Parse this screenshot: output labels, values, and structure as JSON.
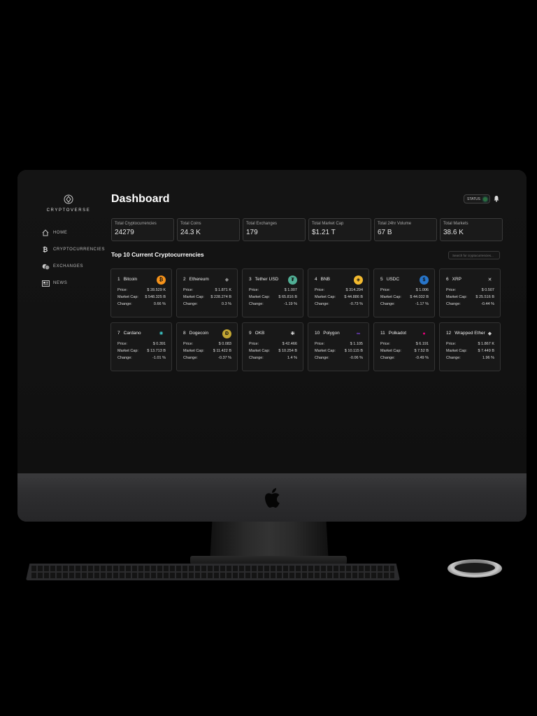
{
  "app": {
    "name": "CRYPTOVERSE"
  },
  "nav": [
    {
      "label": "HOME",
      "icon": "home-icon"
    },
    {
      "label": "CRYPTOCURRENCIES",
      "icon": "bitcoin-icon"
    },
    {
      "label": "EXCHANGES",
      "icon": "coins-icon"
    },
    {
      "label": "NEWS",
      "icon": "newspaper-icon"
    }
  ],
  "header": {
    "title": "Dashboard",
    "status_label": "STATUS"
  },
  "stats": [
    {
      "label": "Total Cryptocurrencies",
      "value": "24279"
    },
    {
      "label": "Total Coins",
      "value": "24.3 K"
    },
    {
      "label": "Total Exchanges",
      "value": "179"
    },
    {
      "label": "Total Market Cap",
      "value": "$1.21 T"
    },
    {
      "label": "Total 24hr Volume",
      "value": "67 B"
    },
    {
      "label": "Total Markets",
      "value": "38.6 K"
    }
  ],
  "section": {
    "title": "Top 10 Current Cryptocurrencies",
    "search_placeholder": "Search for cryptocurrencies..."
  },
  "labels": {
    "price": "Price:",
    "market_cap": "Market Cap:",
    "change": "Change:"
  },
  "coins": [
    {
      "rank": "1",
      "name": "Bitcoin",
      "price": "$ 28.529 K",
      "market_cap": "$ 548.325 B",
      "change": "0.66 %",
      "icon": "bitcoin-coin-icon",
      "color": "#f7931a"
    },
    {
      "rank": "2",
      "name": "Ethereum",
      "price": "$ 1.871 K",
      "market_cap": "$ 228.274 B",
      "change": "0.3 %",
      "icon": "ethereum-coin-icon",
      "color": "#8c8c8c"
    },
    {
      "rank": "3",
      "name": "Tether USD",
      "price": "$ 1.007",
      "market_cap": "$ 65.816 B",
      "change": "-1.19 %",
      "icon": "tether-coin-icon",
      "color": "#50af95"
    },
    {
      "rank": "4",
      "name": "BNB",
      "price": "$ 314.294",
      "market_cap": "$ 44.886 B",
      "change": "-0.73 %",
      "icon": "bnb-coin-icon",
      "color": "#f3ba2f"
    },
    {
      "rank": "5",
      "name": "USDC",
      "price": "$ 1.006",
      "market_cap": "$ 44.032 B",
      "change": "-1.17 %",
      "icon": "usdc-coin-icon",
      "color": "#2775ca"
    },
    {
      "rank": "6",
      "name": "XRP",
      "price": "$ 0.507",
      "market_cap": "$ 25.516 B",
      "change": "-0.44 %",
      "icon": "xrp-coin-icon",
      "color": "#dddddd"
    },
    {
      "rank": "7",
      "name": "Cardano",
      "price": "$ 0.391",
      "market_cap": "$ 13.713 B",
      "change": "-1.01 %",
      "icon": "cardano-coin-icon",
      "color": "#3cc8c8"
    },
    {
      "rank": "8",
      "name": "Dogecoin",
      "price": "$ 0.083",
      "market_cap": "$ 11.422 B",
      "change": "-0.37 %",
      "icon": "dogecoin-coin-icon",
      "color": "#c2a633"
    },
    {
      "rank": "9",
      "name": "OKB",
      "price": "$ 42.466",
      "market_cap": "$ 10.254 B",
      "change": "1.4 %",
      "icon": "okb-coin-icon",
      "color": "#ffffff"
    },
    {
      "rank": "10",
      "name": "Polygon",
      "price": "$ 1.105",
      "market_cap": "$ 10.115 B",
      "change": "-0.06 %",
      "icon": "polygon-coin-icon",
      "color": "#8247e5"
    },
    {
      "rank": "11",
      "name": "Polkadot",
      "price": "$ 6.191",
      "market_cap": "$ 7.52 B",
      "change": "-0.49 %",
      "icon": "polkadot-coin-icon",
      "color": "#e6007a"
    },
    {
      "rank": "12",
      "name": "Wrapped Ether",
      "price": "$ 1.867 K",
      "market_cap": "$ 7.449 B",
      "change": "1.96 %",
      "icon": "wrapped-ether-coin-icon",
      "color": "#cccccc"
    }
  ]
}
